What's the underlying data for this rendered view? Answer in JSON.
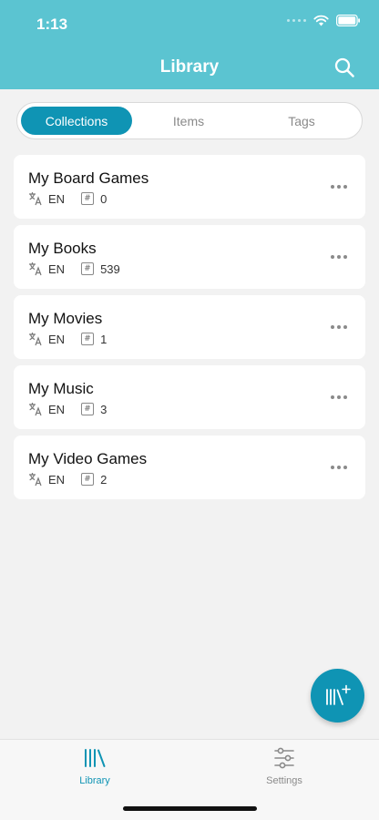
{
  "status": {
    "time": "1:13"
  },
  "header": {
    "title": "Library",
    "search_icon": "search-icon"
  },
  "segments": [
    {
      "label": "Collections",
      "active": true
    },
    {
      "label": "Items",
      "active": false
    },
    {
      "label": "Tags",
      "active": false
    }
  ],
  "collections": [
    {
      "title": "My Board Games",
      "lang": "EN",
      "count": "0"
    },
    {
      "title": "My Books",
      "lang": "EN",
      "count": "539"
    },
    {
      "title": "My Movies",
      "lang": "EN",
      "count": "1"
    },
    {
      "title": "My Music",
      "lang": "EN",
      "count": "3"
    },
    {
      "title": "My Video Games",
      "lang": "EN",
      "count": "2"
    }
  ],
  "count_symbol": "#",
  "fab": {
    "icon": "add-collection-icon"
  },
  "tabbar": {
    "library": {
      "label": "Library",
      "icon": "library-icon"
    },
    "settings": {
      "label": "Settings",
      "icon": "sliders-icon"
    }
  },
  "colors": {
    "header": "#5bc4d1",
    "accent": "#0f94b4",
    "background": "#f2f2f2",
    "inactive": "#8a8a8a"
  }
}
